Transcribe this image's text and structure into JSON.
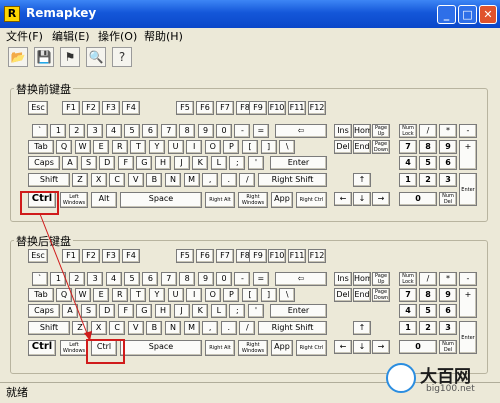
{
  "window": {
    "title": "Remapkey",
    "icon_letter": "R"
  },
  "menu": [
    {
      "label": "文件(F)"
    },
    {
      "label": "编辑(E)"
    },
    {
      "label": "操作(O)"
    },
    {
      "label": "帮助(H)"
    }
  ],
  "toolbar": [
    {
      "name": "open-icon",
      "glyph": "📂"
    },
    {
      "name": "save-icon",
      "glyph": "💾"
    },
    {
      "name": "remap-icon",
      "glyph": "⚑"
    },
    {
      "name": "view-icon",
      "glyph": "🔍"
    },
    {
      "name": "help-icon",
      "glyph": "?"
    }
  ],
  "groups": {
    "before": "替换前键盘",
    "after": "替换后键盘"
  },
  "keyboard": {
    "fkeys": [
      "Esc",
      "F1",
      "F2",
      "F3",
      "F4",
      "F5",
      "F6",
      "F7",
      "F8",
      "F9",
      "F10",
      "F11",
      "F12"
    ],
    "row1": [
      "`",
      "1",
      "2",
      "3",
      "4",
      "5",
      "6",
      "7",
      "8",
      "9",
      "0",
      "-",
      "=",
      "⇦"
    ],
    "row2": [
      "Tab",
      "Q",
      "W",
      "E",
      "R",
      "T",
      "Y",
      "U",
      "I",
      "O",
      "P",
      "[",
      "]",
      "\\"
    ],
    "row3": [
      "Caps",
      "A",
      "S",
      "D",
      "F",
      "G",
      "H",
      "J",
      "K",
      "L",
      ";",
      "'",
      "Enter"
    ],
    "row4": [
      "Shift",
      "Z",
      "X",
      "C",
      "V",
      "B",
      "N",
      "M",
      ",",
      ".",
      "/",
      "Right Shift"
    ],
    "row5_before": [
      "Ctrl",
      "Left Windows",
      "Alt",
      "Space",
      "Right Alt",
      "Right Windows",
      "App",
      "Right Ctrl"
    ],
    "row5_after": [
      "Ctrl",
      "Left Windows",
      "Ctrl",
      "Space",
      "Right Alt",
      "Right Windows",
      "App",
      "Right Ctrl"
    ],
    "nav_top": [
      "Ins",
      "Home",
      "Page Up"
    ],
    "nav_bottom": [
      "Del",
      "End",
      "Page Down"
    ],
    "arrows": [
      "↑",
      "←",
      "↓",
      "→"
    ],
    "numpad": {
      "top": [
        "Num Lock",
        "/",
        "*",
        "-"
      ],
      "r1": [
        "7",
        "8",
        "9"
      ],
      "r2": [
        "4",
        "5",
        "6"
      ],
      "r3": [
        "1",
        "2",
        "3"
      ],
      "zero": "0",
      "del": "Num Del",
      "plus": "+",
      "enter": "Enter"
    }
  },
  "status": "就绪",
  "watermark": {
    "name": "大百网",
    "url": "big100.net"
  },
  "colors": {
    "title_blue": "#0a47c9",
    "highlight_red": "#d01b1b",
    "window_bg": "#ece9d8"
  }
}
